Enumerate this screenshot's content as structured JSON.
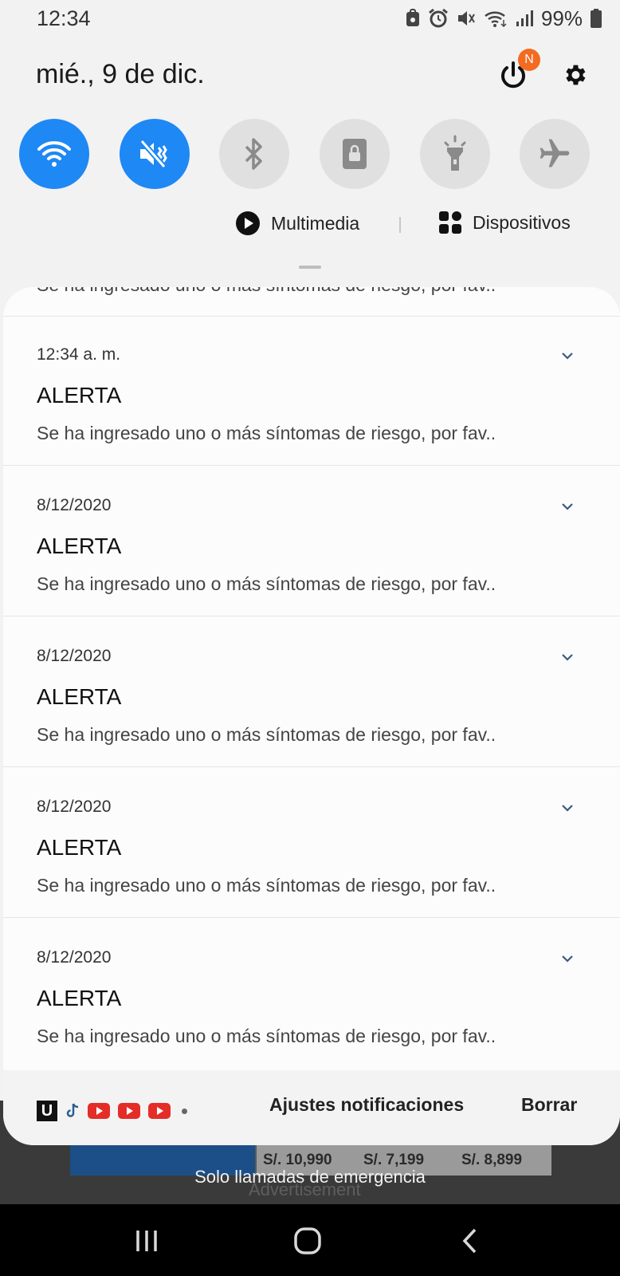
{
  "status_bar": {
    "time": "12:34",
    "battery_percent": "99%"
  },
  "header": {
    "date": "mié., 9 de dic.",
    "badge": "N"
  },
  "quick_toggles": [
    {
      "name": "wifi",
      "state": "on"
    },
    {
      "name": "sound-mute",
      "state": "on"
    },
    {
      "name": "bluetooth",
      "state": "off"
    },
    {
      "name": "screen-lock",
      "state": "off"
    },
    {
      "name": "flashlight",
      "state": "off"
    },
    {
      "name": "airplane",
      "state": "off"
    }
  ],
  "media_row": {
    "multimedia_label": "Multimedia",
    "devices_label": "Dispositivos"
  },
  "previous_notification_body": "Se ha ingresado uno o más síntomas de riesgo, por fav..",
  "notifications": [
    {
      "time": "12:34 a. m.",
      "title": "ALERTA",
      "body": "Se ha ingresado uno o más síntomas de riesgo, por fav.."
    },
    {
      "time": "8/12/2020",
      "title": "ALERTA",
      "body": "Se ha ingresado uno o más síntomas de riesgo, por fav.."
    },
    {
      "time": "8/12/2020",
      "title": "ALERTA",
      "body": "Se ha ingresado uno o más síntomas de riesgo, por fav.."
    },
    {
      "time": "8/12/2020",
      "title": "ALERTA",
      "body": "Se ha ingresado uno o más síntomas de riesgo, por fav.."
    },
    {
      "time": "8/12/2020",
      "title": "ALERTA",
      "body": "Se ha ingresado uno o más síntomas de riesgo, por fav.."
    }
  ],
  "footer": {
    "app_u_label": "U",
    "notification_settings_label": "Ajustes notificaciones",
    "clear_label": "Borrar"
  },
  "background": {
    "ad_prices": [
      "S/. 10,990",
      "S/. 7,199",
      "S/. 8,899"
    ],
    "advertisement_label": "Advertisement",
    "emergency_text": "Solo llamadas de emergencia"
  },
  "colors": {
    "accent": "#1e88f5",
    "badge": "#f36b21"
  }
}
